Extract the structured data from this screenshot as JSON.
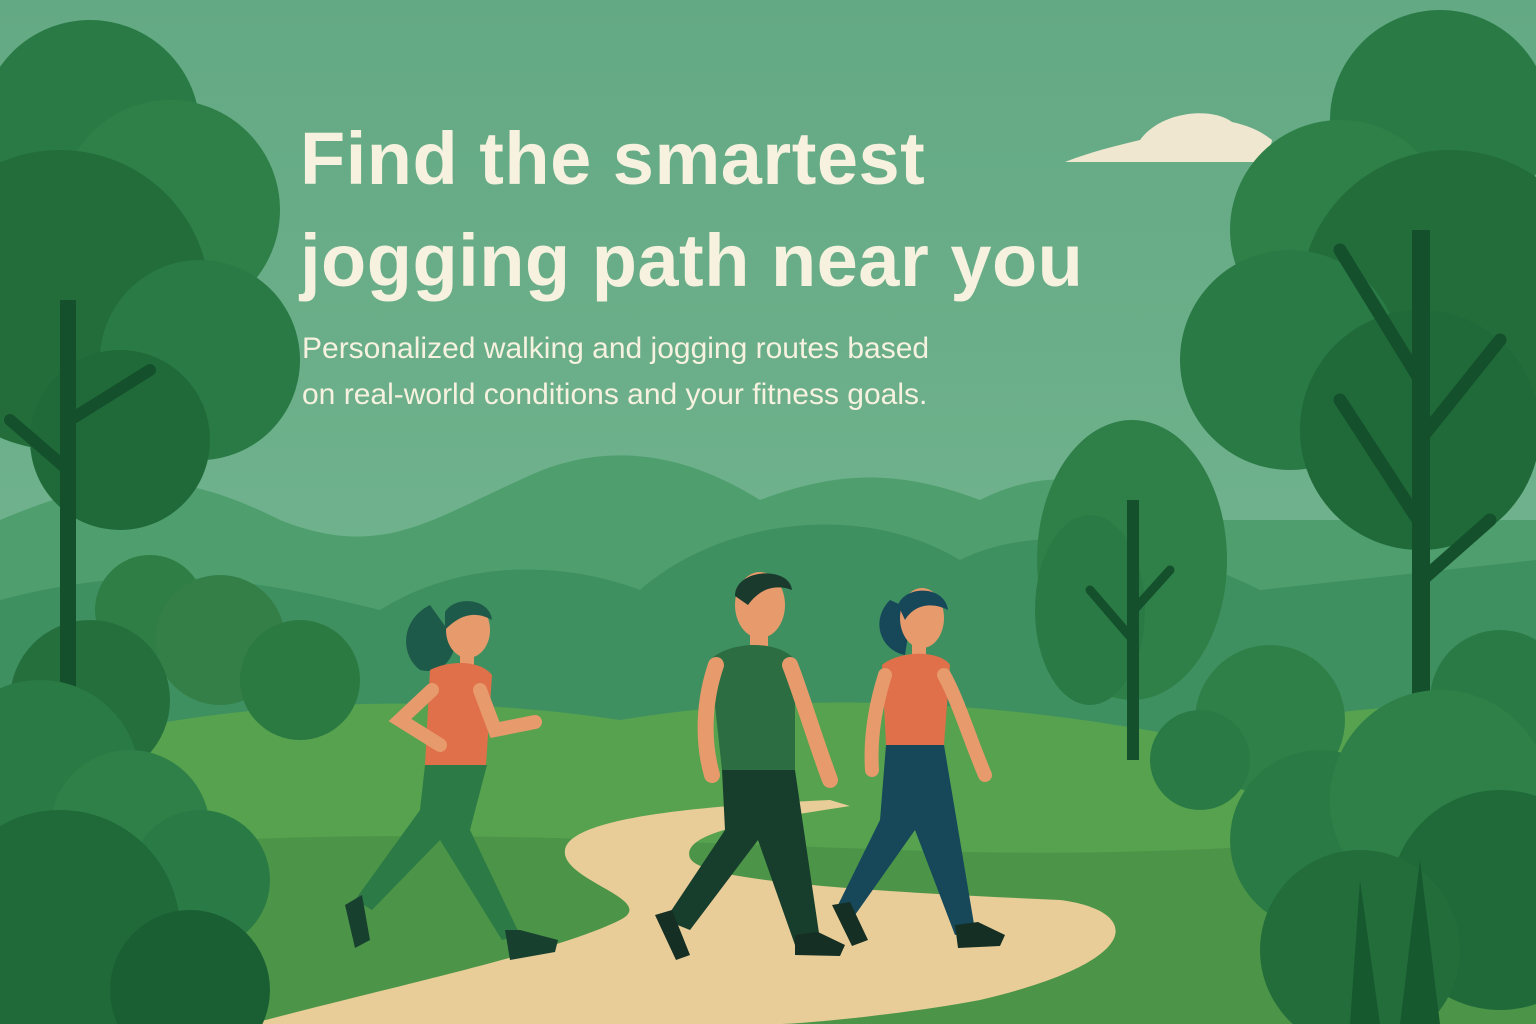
{
  "hero": {
    "headline_line1": "Find the smartest",
    "headline_line2": "jogging path near you",
    "subtitle_line1": "Personalized walking and jogging routes based",
    "subtitle_line2": "on real-world conditions and your fitness goals."
  },
  "colors": {
    "sky": "#6aae8a",
    "text": "#f6f2df",
    "path": "#e8cd98",
    "tree_dark": "#1f6a40",
    "tree_mid": "#2f8048",
    "grass": "#4f9a4c",
    "shirt": "#e0704a",
    "pants_green": "#2c7a45",
    "pants_navy": "#16485a"
  },
  "icons": [
    "cloud-icon",
    "tree-icon",
    "jogger-figure",
    "walker-figure"
  ]
}
